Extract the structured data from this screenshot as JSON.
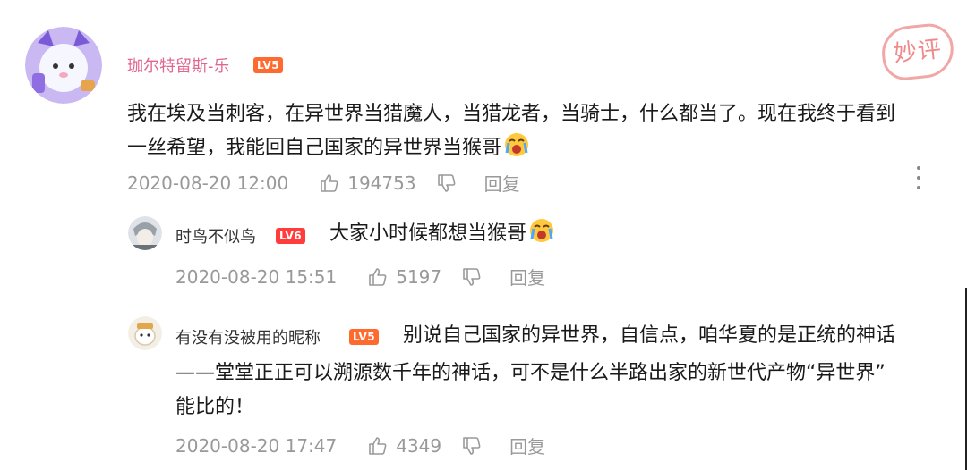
{
  "stamp": {
    "text": "妙评"
  },
  "main_comment": {
    "username": "珈尔特留斯-乐",
    "level": "LV5",
    "text_line1": "我在埃及当刺客，在异世界当猎魔人，当猎龙者，当骑士，什么都当了。现在我终于看到",
    "text_line2": "一丝希望，我能回自己国家的异世界当猴哥",
    "time": "2020-08-20 12:00",
    "likes": "194753",
    "reply_label": "回复"
  },
  "replies": [
    {
      "username": "时鸟不似鸟",
      "level": "LV6",
      "text": "大家小时候都想当猴哥",
      "time": "2020-08-20 15:51",
      "likes": "5197",
      "reply_label": "回复"
    },
    {
      "username": "有没有没被用的昵称",
      "level": "LV5",
      "text_line1": "别说自己国家的异世界，自信点，咱华夏的是正统的神话",
      "text_line2": "——堂堂正正可以溯源数千年的神话，可不是什么半路出家的新世代产物“异世界”",
      "text_line3": "能比的！",
      "time": "2020-08-20 17:47",
      "likes": "4349",
      "reply_label": "回复"
    }
  ],
  "colors": {
    "username_highlight": "#e0688f",
    "level_badge": "#ff6a2e",
    "meta_gray": "#999999",
    "stamp": "#f08a8a"
  },
  "icons": [
    "thumbs-up-icon",
    "thumbs-down-icon",
    "more-vertical-icon",
    "crying-emoji-icon"
  ]
}
